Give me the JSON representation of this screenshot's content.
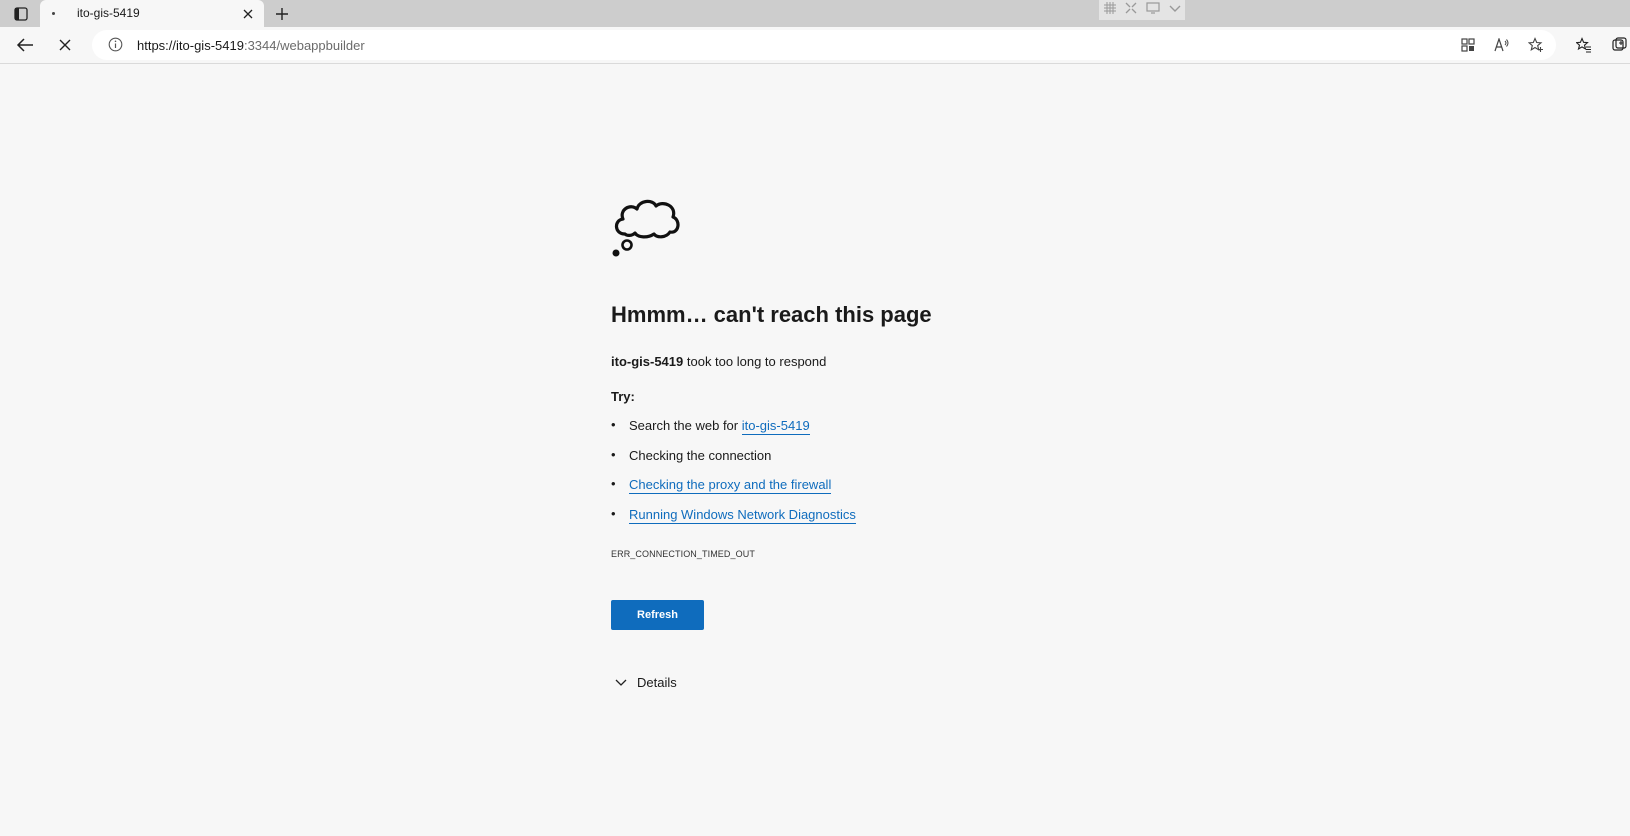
{
  "tab": {
    "title": "ito-gis-5419"
  },
  "address_bar": {
    "url_host": "https://ito-gis-5419",
    "url_rest": ":3344/webappbuilder"
  },
  "error": {
    "heading": "Hmmm… can't reach this page",
    "host": "ito-gis-5419",
    "message": "took too long to respond",
    "try_label": "Try:",
    "suggestions": {
      "search_prefix": "Search the web for",
      "search_link": "ito-gis-5419",
      "check_connection": "Checking the connection",
      "check_proxy": "Checking the proxy and the firewall",
      "run_diagnostics": "Running Windows Network Diagnostics"
    },
    "code": "ERR_CONNECTION_TIMED_OUT",
    "refresh_label": "Refresh",
    "details_label": "Details"
  },
  "colors": {
    "accent": "#0f6cbd",
    "background": "#f7f7f7",
    "tabstrip": "#cdcdcd"
  }
}
